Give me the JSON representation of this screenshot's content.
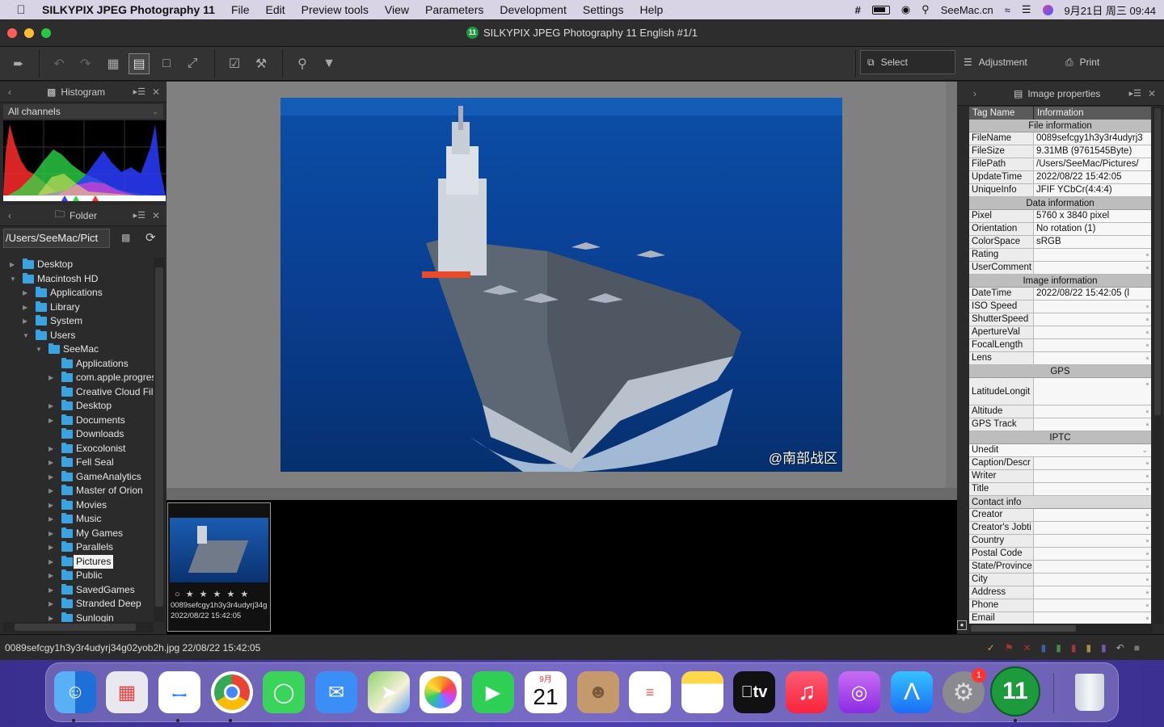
{
  "menubar": {
    "app_name": "SILKYPIX JPEG Photography 11",
    "items": [
      "File",
      "Edit",
      "Preview tools",
      "View",
      "Parameters",
      "Development",
      "Settings",
      "Help"
    ],
    "site": "SeeMac.cn",
    "clock": "9月21日 周三  09:44"
  },
  "window": {
    "title": "SILKYPIX JPEG Photography 11 English   #1/1",
    "app_icon_text": "11"
  },
  "toolbar": {
    "select_label": "Select",
    "adjustment_label": "Adjustment",
    "print_label": "Print"
  },
  "histogram": {
    "title": "Histogram",
    "channel": "All channels"
  },
  "folder": {
    "title": "Folder",
    "path": "/Users/SeeMac/Pict",
    "tree": [
      {
        "label": "Desktop",
        "level": 0,
        "state": "collapsed"
      },
      {
        "label": "Macintosh HD",
        "level": 0,
        "state": "expanded"
      },
      {
        "label": "Applications",
        "level": 1,
        "state": "collapsed"
      },
      {
        "label": "Library",
        "level": 1,
        "state": "collapsed"
      },
      {
        "label": "System",
        "level": 1,
        "state": "collapsed"
      },
      {
        "label": "Users",
        "level": 1,
        "state": "expanded"
      },
      {
        "label": "SeeMac",
        "level": 2,
        "state": "expanded"
      },
      {
        "label": "Applications",
        "level": 3,
        "state": "none"
      },
      {
        "label": "com.apple.progres",
        "level": 3,
        "state": "collapsed"
      },
      {
        "label": "Creative Cloud File",
        "level": 3,
        "state": "none"
      },
      {
        "label": "Desktop",
        "level": 3,
        "state": "collapsed"
      },
      {
        "label": "Documents",
        "level": 3,
        "state": "collapsed"
      },
      {
        "label": "Downloads",
        "level": 3,
        "state": "none"
      },
      {
        "label": "Exocolonist",
        "level": 3,
        "state": "collapsed"
      },
      {
        "label": "Fell Seal",
        "level": 3,
        "state": "collapsed"
      },
      {
        "label": "GameAnalytics",
        "level": 3,
        "state": "collapsed"
      },
      {
        "label": "Master of Orion",
        "level": 3,
        "state": "collapsed"
      },
      {
        "label": "Movies",
        "level": 3,
        "state": "collapsed"
      },
      {
        "label": "Music",
        "level": 3,
        "state": "collapsed"
      },
      {
        "label": "My Games",
        "level": 3,
        "state": "collapsed"
      },
      {
        "label": "Parallels",
        "level": 3,
        "state": "collapsed"
      },
      {
        "label": "Pictures",
        "level": 3,
        "state": "selected"
      },
      {
        "label": "Public",
        "level": 3,
        "state": "collapsed"
      },
      {
        "label": "SavedGames",
        "level": 3,
        "state": "collapsed"
      },
      {
        "label": "Stranded Deep",
        "level": 3,
        "state": "collapsed"
      },
      {
        "label": "Sunlogin",
        "level": 3,
        "state": "collapsed"
      }
    ]
  },
  "preview": {
    "watermark": "@南部战区"
  },
  "thumbnail": {
    "filename": "0089sefcgy1h3y3r4udyrj34g",
    "datetime": "2022/08/22 15:42:05",
    "stars": "○ ★ ★ ★ ★ ★"
  },
  "image_properties": {
    "title": "Image properties",
    "col_tag": "Tag Name",
    "col_info": "Information",
    "rows": [
      {
        "type": "section",
        "label": "File information"
      },
      {
        "type": "row",
        "k": "FileName",
        "v": "0089sefcgy1h3y3r4udyrj3"
      },
      {
        "type": "row",
        "k": "FileSize",
        "v": "9.31MB (9761545Byte)"
      },
      {
        "type": "row",
        "k": "FilePath",
        "v": "/Users/SeeMac/Pictures/"
      },
      {
        "type": "row",
        "k": "UpdateTime",
        "v": "2022/08/22 15:42:05"
      },
      {
        "type": "row",
        "k": "UniqueInfo",
        "v": "JFIF YCbCr(4:4:4)"
      },
      {
        "type": "section",
        "label": "Data information"
      },
      {
        "type": "row",
        "k": "Pixel",
        "v": "5760 x 3840 pixel"
      },
      {
        "type": "row",
        "k": "Orientation",
        "v": "No rotation (1)"
      },
      {
        "type": "row",
        "k": "ColorSpace",
        "v": "sRGB"
      },
      {
        "type": "row",
        "k": "Rating",
        "v": ""
      },
      {
        "type": "row",
        "k": "UserComment",
        "v": ""
      },
      {
        "type": "section",
        "label": "Image information"
      },
      {
        "type": "row",
        "k": "DateTime",
        "v": "2022/08/22 15:42:05 (l"
      },
      {
        "type": "row",
        "k": "ISO Speed",
        "v": ""
      },
      {
        "type": "row",
        "k": "ShutterSpeed",
        "v": ""
      },
      {
        "type": "row",
        "k": "ApertureVal",
        "v": ""
      },
      {
        "type": "row",
        "k": "FocalLength",
        "v": ""
      },
      {
        "type": "row",
        "k": "Lens",
        "v": ""
      },
      {
        "type": "section",
        "label": "GPS"
      },
      {
        "type": "tall",
        "k": "LatitudeLongit",
        "v": ""
      },
      {
        "type": "row",
        "k": "Altitude",
        "v": ""
      },
      {
        "type": "row",
        "k": "GPS Track",
        "v": ""
      },
      {
        "type": "section",
        "label": "IPTC"
      },
      {
        "type": "select",
        "k": "Unedit",
        "v": ""
      },
      {
        "type": "row",
        "k": "Caption/Descr",
        "v": ""
      },
      {
        "type": "row",
        "k": "Writer",
        "v": ""
      },
      {
        "type": "row",
        "k": "Title",
        "v": ""
      },
      {
        "type": "subsection",
        "label": "Contact info"
      },
      {
        "type": "row",
        "k": "Creator",
        "v": ""
      },
      {
        "type": "row",
        "k": "Creator's Jobti",
        "v": ""
      },
      {
        "type": "row",
        "k": "Country",
        "v": ""
      },
      {
        "type": "row",
        "k": "Postal Code",
        "v": ""
      },
      {
        "type": "row",
        "k": "State/Province",
        "v": ""
      },
      {
        "type": "row",
        "k": "City",
        "v": ""
      },
      {
        "type": "row",
        "k": "Address",
        "v": ""
      },
      {
        "type": "row",
        "k": "Phone",
        "v": ""
      },
      {
        "type": "row",
        "k": "Email",
        "v": ""
      }
    ]
  },
  "statusbar": {
    "text": "0089sefcgy1h3y3r4udyrj34g02yob2h.jpg 22/08/22 15:42:05"
  },
  "dock": {
    "calendar_month": "9月",
    "calendar_day": "21",
    "tv_label": "tv",
    "badge": "1",
    "silkypix_label": "11",
    "apps": [
      "finder-icon",
      "launchpad-icon",
      "safari-icon",
      "chrome-icon",
      "messages-icon",
      "mail-icon",
      "maps-icon",
      "photos-icon",
      "facetime-icon",
      "calendar-icon",
      "contacts-icon",
      "reminders-icon",
      "notes-icon",
      "appletv-icon",
      "music-icon",
      "podcasts-icon",
      "appstore-icon",
      "system-preferences-icon",
      "silkypix-icon",
      "trash-icon"
    ]
  },
  "colors": {
    "accent_folder": "#3aa3e0",
    "panel_bg": "#2b2b2b",
    "preview_bg": "#808080",
    "dock_bg": "#4e3fb0"
  }
}
